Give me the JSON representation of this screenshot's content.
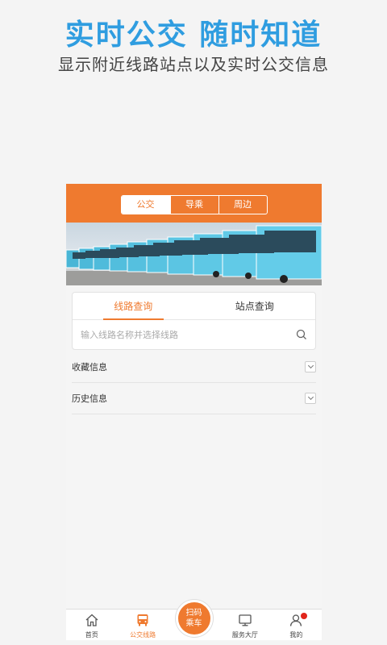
{
  "promo": {
    "title": "实时公交  随时知道",
    "subtitle": "显示附近线路站点以及实时公交信息"
  },
  "header": {
    "segments": [
      "公交",
      "导乘",
      "周边"
    ],
    "active_segment": 0
  },
  "query": {
    "tabs": [
      "线路查询",
      "站点查询"
    ],
    "active_tab": 0,
    "search_placeholder": "输入线路名称并选择线路"
  },
  "sections": [
    "收藏信息",
    "历史信息"
  ],
  "tabbar": {
    "items": [
      "首页",
      "公交线路",
      "扫码乘车",
      "服务大厅",
      "我的"
    ],
    "scan_lines": [
      "扫码",
      "乘车"
    ],
    "active_index": 1
  },
  "colors": {
    "accent": "#ef7a2f",
    "promo_title": "#2f9de0",
    "badge": "#e1251b"
  }
}
